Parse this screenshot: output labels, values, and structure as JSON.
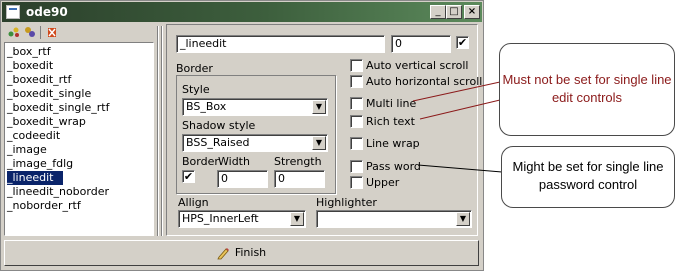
{
  "window": {
    "title": "ode90",
    "minimize": "_",
    "maximize": "□",
    "close": "×"
  },
  "toolbar": {
    "icons": [
      "properties-icon",
      "add-icon",
      "delete-icon"
    ]
  },
  "list": {
    "items": [
      "_box_rtf",
      "_boxedit",
      "_boxedit_rtf",
      "_boxedit_single",
      "_boxedit_single_rtf",
      "_boxedit_wrap",
      "_codeedit",
      "_image",
      "_image_fdlg",
      "_lineedit",
      "_lineedit_noborder",
      "_noborder_rtf"
    ],
    "selected": "_lineedit"
  },
  "form": {
    "name_value": "_lineedit",
    "number_value": "0",
    "top_checked": true,
    "border_label": "Border",
    "style_label": "Style",
    "style_value": "BS_Box",
    "shadow_label": "Shadow style",
    "shadow_value": "BSS_Raised",
    "border_cb_label": "Border",
    "border_checked": true,
    "width_label": "Width",
    "width_value": "0",
    "strength_label": "Strength",
    "strength_value": "0",
    "allign_label": "Allign",
    "allign_value": "HPS_InnerLeft",
    "highlighter_label": "Highlighter",
    "highlighter_value": "",
    "options": [
      {
        "label": "Auto vertical scroll",
        "checked": false
      },
      {
        "label": "Auto horizontal scroll",
        "checked": false
      },
      {
        "label": "Multi line",
        "checked": false
      },
      {
        "label": "Rich text",
        "checked": false
      },
      {
        "label": "Line wrap",
        "checked": false
      },
      {
        "label": "Pass word",
        "checked": false
      },
      {
        "label": "Upper",
        "checked": false
      }
    ]
  },
  "finish_label": "Finish",
  "annotations": {
    "callout1": "Must not be set for single line edit controls",
    "callout1_color": "#8b1a1a",
    "callout2": "Might be set for single line password control",
    "callout2_color": "#000000"
  }
}
